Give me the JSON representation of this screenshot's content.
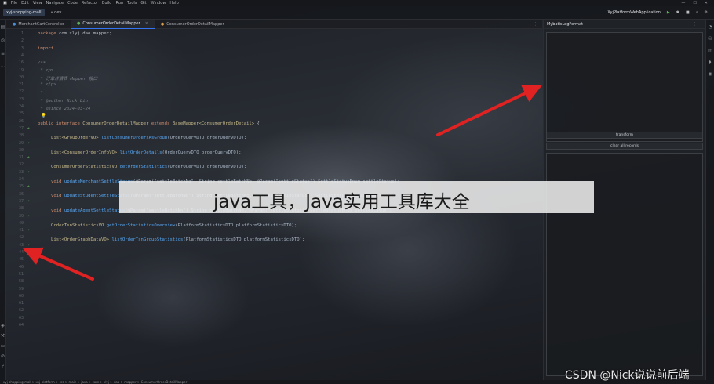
{
  "menu": [
    "File",
    "Edit",
    "View",
    "Navigate",
    "Code",
    "Refactor",
    "Build",
    "Run",
    "Tools",
    "Git",
    "Window",
    "Help"
  ],
  "window_controls": [
    "—",
    "☐",
    "✕"
  ],
  "toolbar": {
    "project": "xyj-shopping-mall",
    "branch": "dev",
    "run_config": "XyjPlatformWebApplication",
    "icons": [
      "run-icon",
      "debug-icon",
      "stop-icon",
      "search-icon",
      "settings-icon"
    ]
  },
  "tabs": [
    {
      "label": "MerchantCartController",
      "active": false
    },
    {
      "label": "ConsumerOrderDetailMapper",
      "active": true
    },
    {
      "label": "ConsumerOrderDetailMapper",
      "active": false
    }
  ],
  "gutter": {
    "lines": [
      "1",
      "2",
      "3",
      "4",
      "16",
      "19",
      "20",
      "21",
      "22",
      "23",
      "24",
      "25",
      "26",
      "27",
      "28",
      "29",
      "30",
      "31",
      "32",
      "33",
      "34",
      "35",
      "36",
      "37",
      "38",
      "39",
      "40",
      "41",
      "42",
      "43",
      "44",
      "45",
      "46",
      "51",
      "58",
      "59",
      "60",
      "61",
      "62",
      "63",
      "64"
    ]
  },
  "code": {
    "package": [
      "package",
      " com.xlyj.dao.mapper;"
    ],
    "import": [
      "import",
      " ..."
    ],
    "doc": [
      "/**",
      " * <p>",
      " * 订单详情表 Mapper 接口",
      " * </p>",
      " *",
      " * @author Nick Lin",
      " * @since 2024-03-24"
    ],
    "decl": [
      "public interface",
      " ConsumerOrderDetailMapper",
      " extends",
      " BaseMapper<ConsumerOrderDetail>",
      " {"
    ],
    "methods": [
      {
        "ret": "List<GroupOrderVO>",
        "name": "listConsumerOrdersAsGroup",
        "params": "(OrderQueryDTO orderQueryDTO);"
      },
      {
        "ret": "List<ConsumerOrderInfoVO>",
        "name": "listOrderDetails",
        "params": "(OrderQueryDTO orderQueryDTO);"
      },
      {
        "ret": "ConsumerOrderStatisticsVO",
        "name": "getOrderStatistics",
        "params": "(OrderQueryDTO orderQueryDTO);"
      },
      {
        "ret": "void",
        "name": "updateMerchantSettleStatus",
        "params": "(@Param(\"settleBatchNo\") String settleBatchNo, @Param(\"settleStatus\") SettleStatusEnum settleStatus);"
      },
      {
        "ret": "void",
        "name": "updateStudentSettleStatus",
        "params": "(@Param(\"settleBatchNo\") String settleBatchNo, @Param(\"settleStatus\") SettleStatusEnum settleStatus);"
      },
      {
        "ret": "void",
        "name": "updateAgentSettleStatus",
        "params": "(@Param(\"settleBatchNo\") String settleBatchNo, @Param(\"settleStatus\") SettleStatusEnum settleStatus);"
      },
      {
        "ret": "OrderTsnStatisticsVO",
        "name": "getOrderStatisticsOverview",
        "params": "(PlatformStatisticsDTO platformStatisticsDTO);"
      },
      {
        "ret": "List<OrderGraphDataVO>",
        "name": "listOrderTsnGroupStatistics",
        "params": "(PlatformStatisticsDTO platformStatisticsDTO);"
      }
    ]
  },
  "mybatis_panel": {
    "title": "MybatisLogFormat",
    "transform_label": "transform",
    "clear_label": "clear all records"
  },
  "status": {
    "path": "xyj-shopping-mall > xyj-platform > src > main > java > com > xlyj > dao > mapper > ConsumerOrderDetailMapper"
  },
  "caption": "java工具，Java实用工具库大全",
  "watermark": "CSDN @Nick说说前后端",
  "colors": {
    "arrow": "#e02222",
    "accent": "#3574f0"
  }
}
